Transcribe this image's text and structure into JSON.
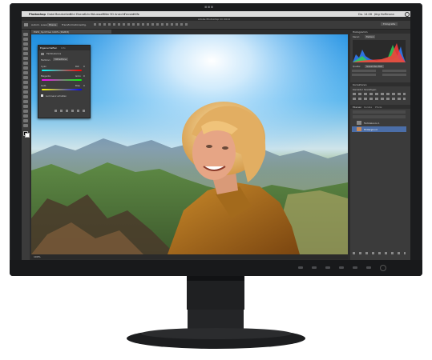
{
  "app": {
    "name": "Photoshop",
    "window_title": "Adobe Photoshop CC 2014",
    "workspace": "Fotografie",
    "clock": "Do. 14:28",
    "user": "Jörg Hoffmann"
  },
  "menubar": {
    "items": [
      "Photoshop",
      "Datei",
      "Bearbeiten",
      "Bild",
      "Ebene",
      "Schrift",
      "Auswahl",
      "Filter",
      "3D",
      "Ansicht",
      "Fenster",
      "Hilfe"
    ]
  },
  "document": {
    "tab_label": "EIZO_hp.tif bei 100% (RGB/8)",
    "zoom_status": "100%"
  },
  "options_bar": {
    "auto_select": "Autom. ausw.",
    "target": "Ebene",
    "transform": "Transformationsstrg."
  },
  "properties_panel": {
    "tabs": [
      "Eigenschaften",
      "Info"
    ],
    "title": "Farbbalance",
    "tone_label": "Farbton:",
    "tone_value": "Mitteltöne",
    "sliders": [
      {
        "left": "Cyan",
        "right": "Rot",
        "value": 0
      },
      {
        "left": "Magenta",
        "right": "Grün",
        "value": 0
      },
      {
        "left": "Gelb",
        "right": "Blau",
        "value": 0
      }
    ],
    "checkbox_label": "Luminanz erhalten"
  },
  "histogram_panel": {
    "title": "Histogramm",
    "channel_label": "Kanal:",
    "channel_value": "Farben",
    "source_label": "Quelle:",
    "source_value": "Gesamtes Bild"
  },
  "adjustments_panel": {
    "title": "Korrekturen",
    "subtitle": "Korrektur hinzufügen"
  },
  "layers_panel": {
    "tabs": [
      "Ebenen",
      "Kanäle",
      "Pfade"
    ],
    "layers": [
      "Farbbalance 1",
      "Hintergrund"
    ]
  },
  "colors": {
    "bezel": "#1b1c1e",
    "ui_dark": "#3b3b3b",
    "sky": "#1e8ee0",
    "jacket": "#b0701c",
    "hist_blue": "#2f7fff",
    "hist_green": "#33cc55",
    "hist_red": "#ff3b3b"
  }
}
